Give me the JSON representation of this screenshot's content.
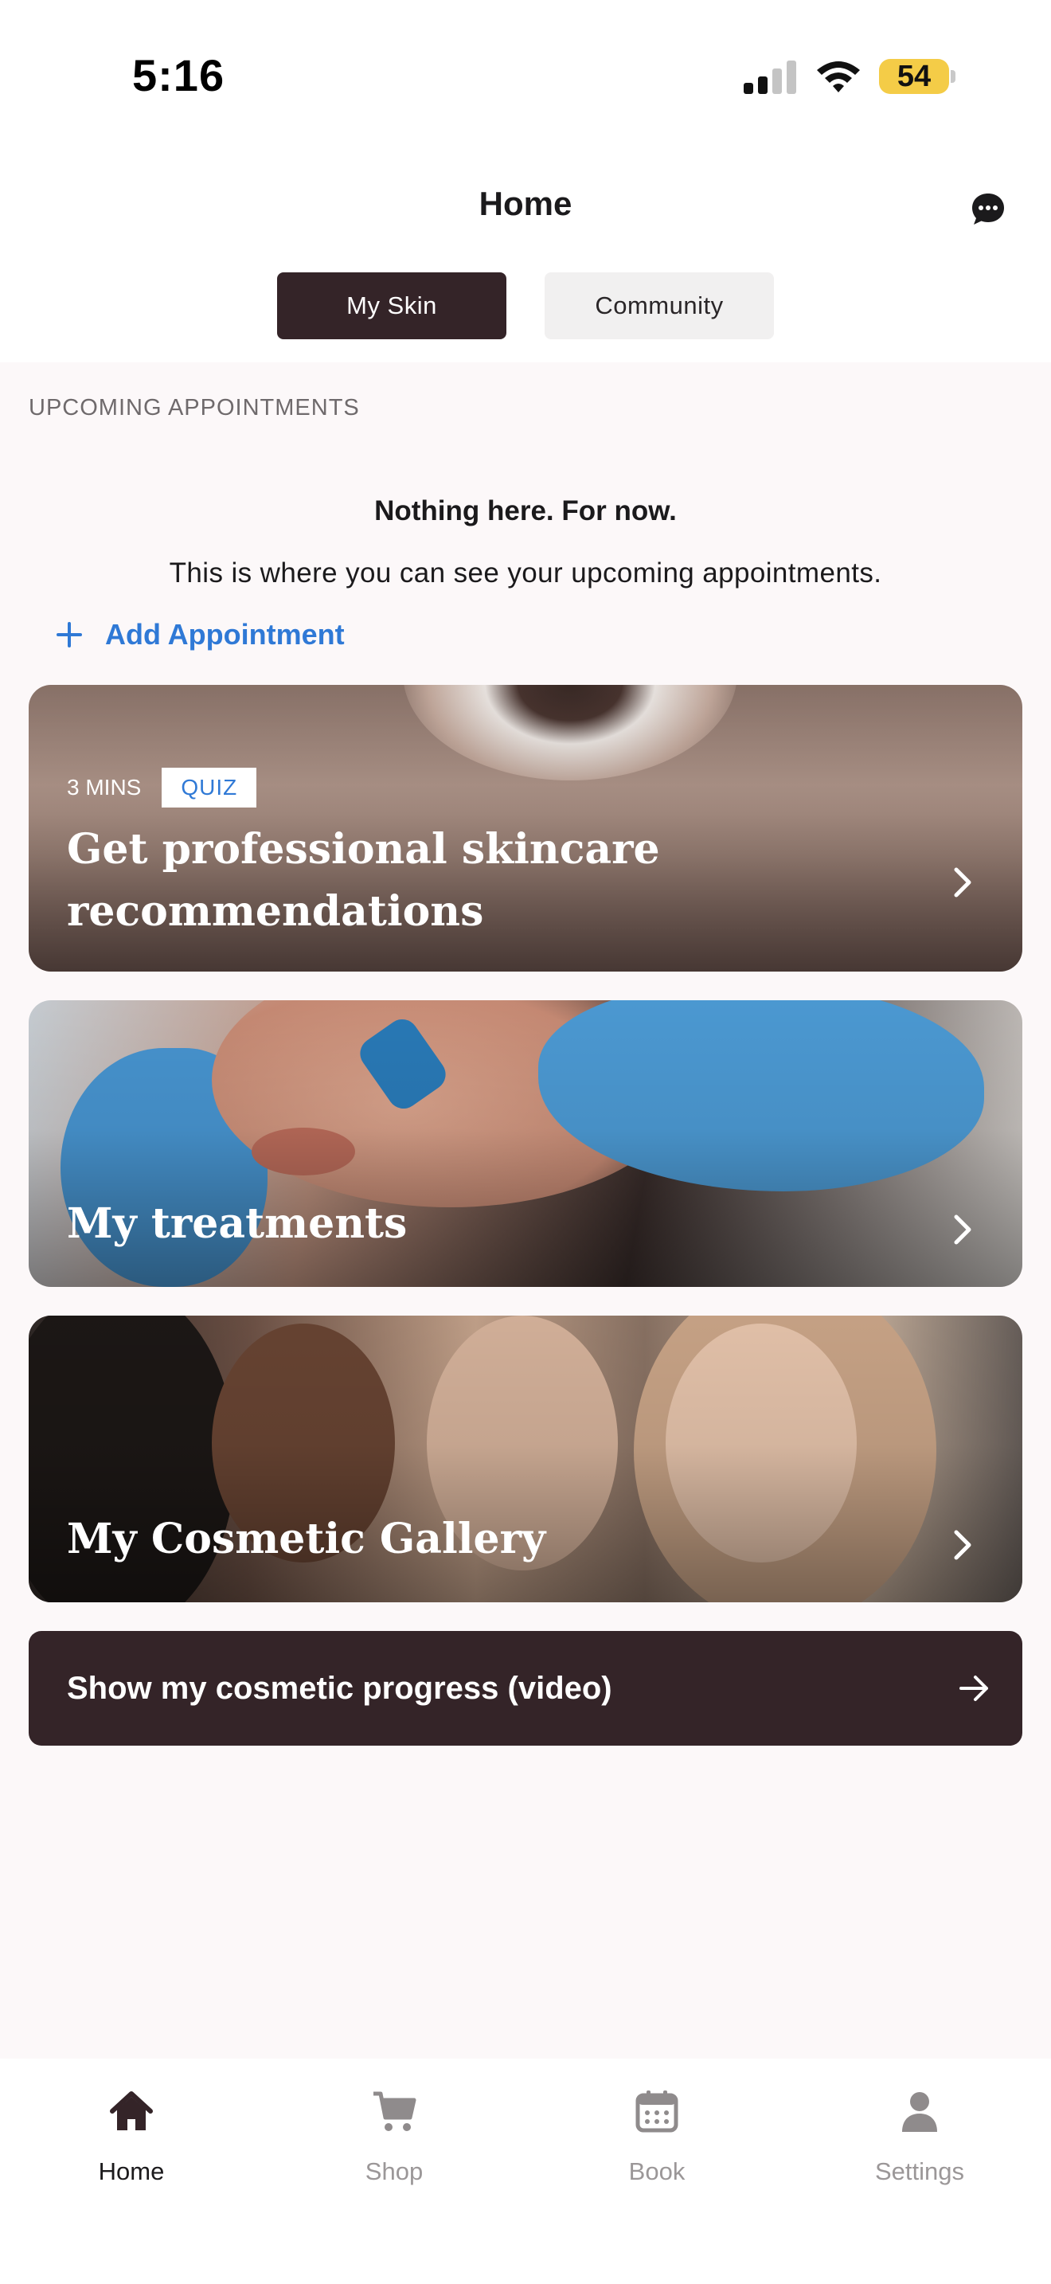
{
  "status_bar": {
    "time": "5:16",
    "battery": "54"
  },
  "header": {
    "title": "Home",
    "chat_icon": "chat-bubble-icon"
  },
  "tabs": [
    {
      "label": "My Skin",
      "active": true
    },
    {
      "label": "Community",
      "active": false
    }
  ],
  "appointments": {
    "section_label": "UPCOMING APPOINTMENTS",
    "empty_title": "Nothing here. For now.",
    "empty_description": "This is where you can see your upcoming appointments.",
    "add_label": "Add Appointment"
  },
  "cards": [
    {
      "duration": "3 MINS",
      "badge": "QUIZ",
      "title": "Get professional skincare recommendations"
    },
    {
      "title": "My treatments"
    },
    {
      "title": "My Cosmetic Gallery"
    }
  ],
  "progress_button": {
    "label": "Show my cosmetic progress (video)"
  },
  "bottom_nav": [
    {
      "label": "Home",
      "icon": "home-icon",
      "active": true
    },
    {
      "label": "Shop",
      "icon": "cart-icon",
      "active": false
    },
    {
      "label": "Book",
      "icon": "calendar-icon",
      "active": false
    },
    {
      "label": "Settings",
      "icon": "person-icon",
      "active": false
    }
  ],
  "colors": {
    "brand_dark": "#342428",
    "accent_blue": "#2f79d6",
    "battery_yellow": "#f4cc47",
    "background": "#fcf8f9"
  }
}
